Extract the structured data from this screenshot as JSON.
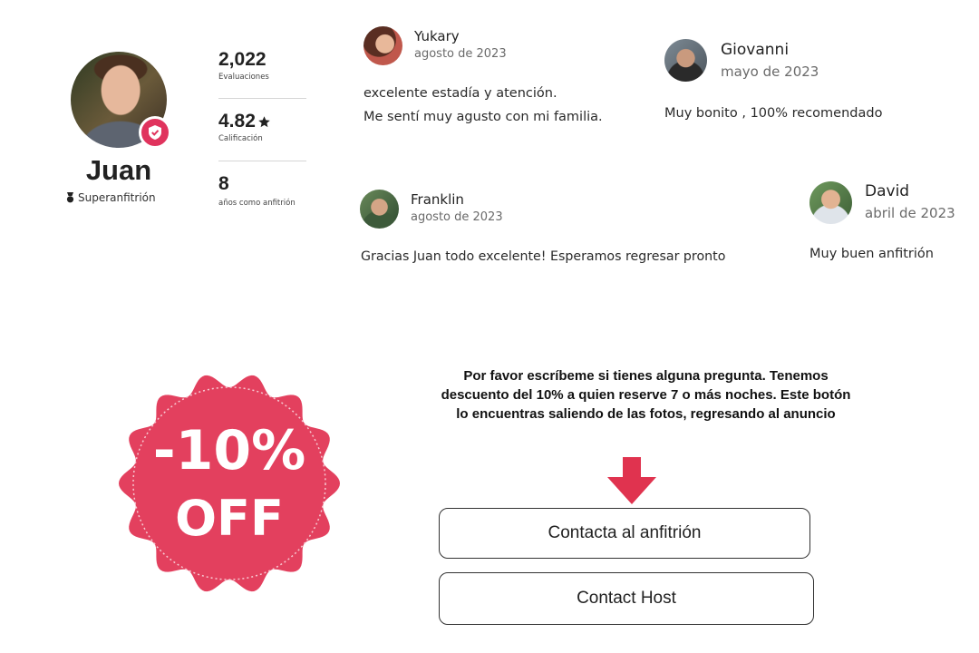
{
  "host": {
    "name": "Juan",
    "superhost_label": "Superanfitrión",
    "stats": [
      {
        "value": "2,022",
        "label": "Evaluaciones"
      },
      {
        "value": "4.82",
        "label": "Calificación"
      },
      {
        "value": "8",
        "label": "años como anfitrión"
      }
    ]
  },
  "reviews": [
    {
      "name": "Yukary",
      "date": "agosto de 2023",
      "text_lines": [
        "excelente estadía y atención.",
        "Me sentí muy agusto con mi familia."
      ]
    },
    {
      "name": "Giovanni",
      "date": "mayo de 2023",
      "text_lines": [
        "Muy bonito , 100% recomendado"
      ]
    },
    {
      "name": "Franklin",
      "date": "agosto de 2023",
      "text_lines": [
        "Gracias Juan todo excelente! Esperamos regresar pronto"
      ]
    },
    {
      "name": "David",
      "date": "abril de 2023",
      "text_lines": [
        "Muy buen anfitrión"
      ]
    }
  ],
  "promo": {
    "badge_line1": "-10%",
    "badge_line2": "OFF",
    "message_lines": [
      "Por favor escríbeme si tienes alguna pregunta. Tenemos",
      "descuento del 10% a quien reserve 7 o más noches. Este botón",
      "lo encuentras saliendo de las fotos, regresando al anuncio"
    ],
    "button_es": "Contacta al anfitrión",
    "button_en": "Contact Host"
  },
  "colors": {
    "accent": "#e0335d",
    "badge": "#e3405e",
    "arrow": "#e0334f"
  },
  "icons": {
    "verified": "shield-check-icon",
    "superhost": "superhost-medal-icon",
    "rating": "star-icon",
    "arrow": "arrow-down-icon"
  }
}
